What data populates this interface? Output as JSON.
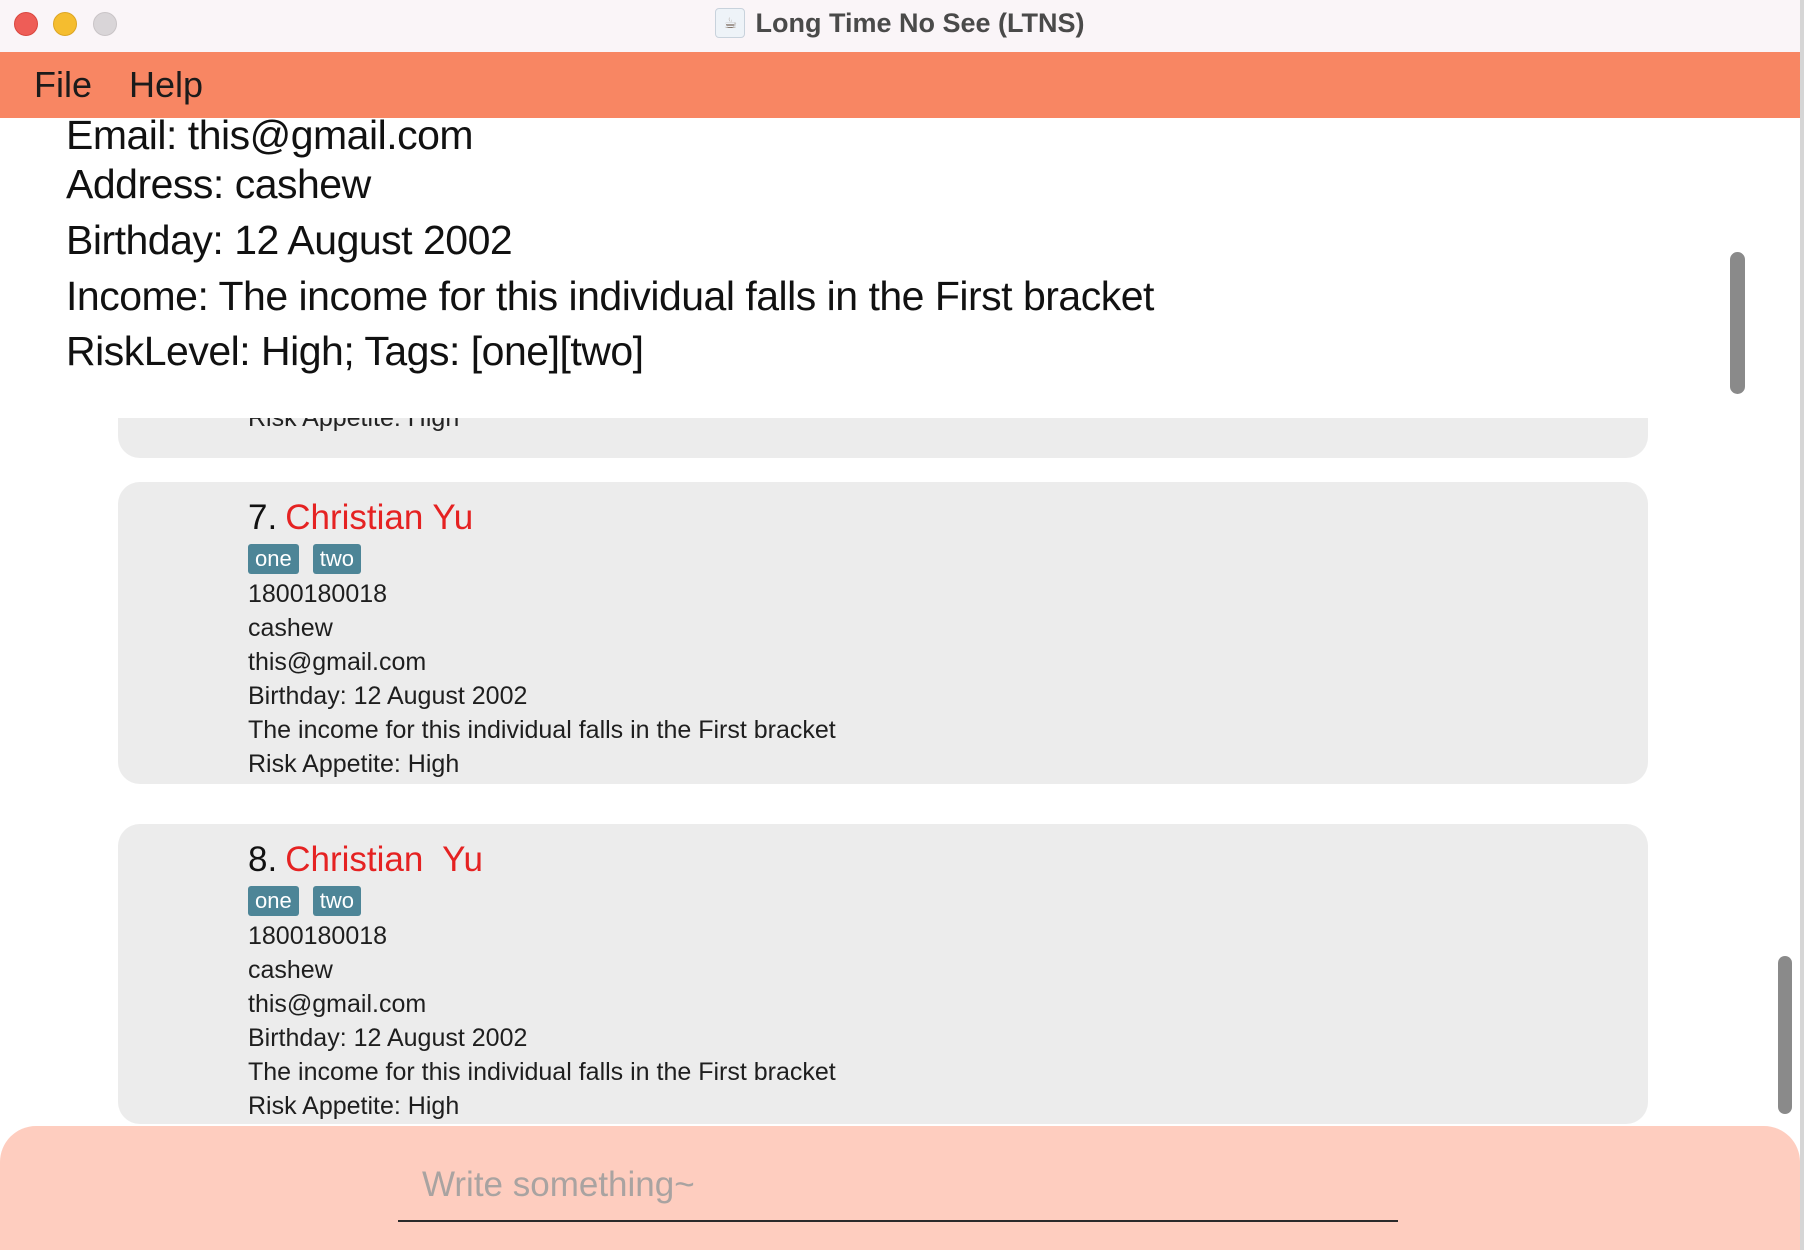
{
  "window": {
    "title": "Long Time No See (LTNS)",
    "icon": "ltns-app-icon"
  },
  "menu": {
    "file": "File",
    "help": "Help"
  },
  "result_display": {
    "lines": [
      "Email: this@gmail.com",
      "Address: cashew",
      "Birthday: 12 August 2002",
      "Income: The income for this individual falls in the First bracket",
      "RiskLevel: High; Tags: [one][two]"
    ]
  },
  "partial_card": {
    "risk": "Risk Appetite: High"
  },
  "persons": [
    {
      "index": "7.",
      "name": "Christian Yu",
      "tags": [
        "one",
        "two"
      ],
      "phone": "1800180018",
      "address": "cashew",
      "email": "this@gmail.com",
      "birthday": "Birthday: 12 August 2002",
      "income": "The income for this individual falls in the First bracket",
      "risk": "Risk Appetite: High"
    },
    {
      "index": "8.",
      "name": "Christian  Yu",
      "tags": [
        "one",
        "two"
      ],
      "phone": "1800180018",
      "address": "cashew",
      "email": "this@gmail.com",
      "birthday": "Birthday: 12 August 2002",
      "income": "The income for this individual falls in the First bracket",
      "risk": "Risk Appetite: High"
    }
  ],
  "command_box": {
    "placeholder": "Write something~",
    "value": ""
  },
  "colors": {
    "menu_bar": "#f88663",
    "command_area": "#fecdbf",
    "name": "#e52222",
    "tag": "#4d8597",
    "card": "#ececec"
  }
}
